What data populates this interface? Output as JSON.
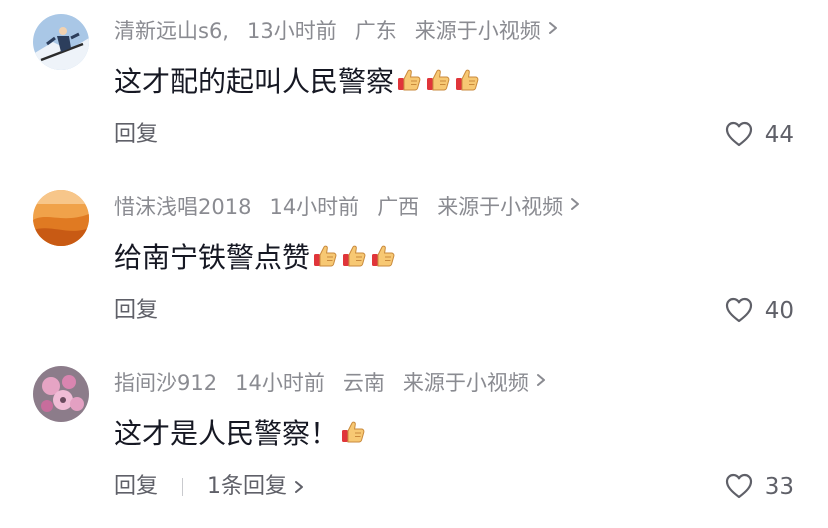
{
  "comments": [
    {
      "username": "清新远山s6,",
      "time": "13小时前",
      "location": "广东",
      "source": "来源于小视频",
      "text": "这才配的起叫人民警察",
      "thumbs_count": 3,
      "reply_label": "回复",
      "replies_text": "",
      "likes": "44",
      "avatar_icon": "skier-avatar"
    },
    {
      "username": "惜沫浅唱2018",
      "time": "14小时前",
      "location": "广西",
      "source": "来源于小视频",
      "text": "给南宁铁警点赞",
      "thumbs_count": 3,
      "reply_label": "回复",
      "replies_text": "",
      "likes": "40",
      "avatar_icon": "desert-avatar"
    },
    {
      "username": "指间沙912",
      "time": "14小时前",
      "location": "云南",
      "source": "来源于小视频",
      "text": "这才是人民警察！",
      "thumbs_count": 1,
      "reply_label": "回复",
      "replies_text": "1条回复",
      "likes": "33",
      "avatar_icon": "flower-avatar"
    }
  ],
  "icons": {
    "thumb": "thumbs-up-emoji",
    "like": "heart-outline-icon",
    "chevron": "chevron-right-icon"
  },
  "colors": {
    "meta_text": "#8a8b91",
    "body_text": "#161823",
    "action_text": "#5f6068",
    "thumb_fill": "#f7c873",
    "thumb_cuff": "#e0353a"
  }
}
